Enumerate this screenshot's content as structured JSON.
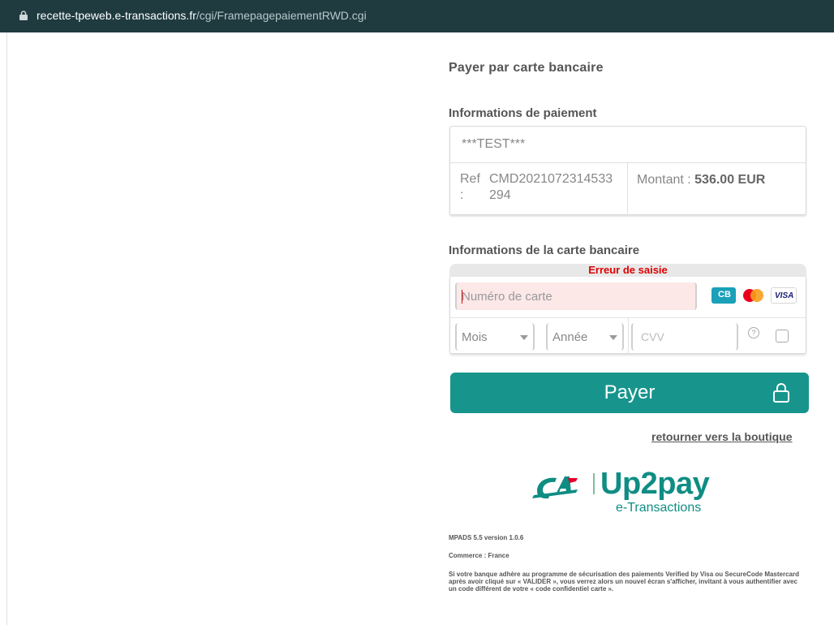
{
  "browser": {
    "url_host": "recette-tpeweb.e-transactions.fr",
    "url_path": "/cgi/FramepagepaiementRWD.cgi"
  },
  "page": {
    "title": "Payer par carte bancaire",
    "payment_info_title": "Informations de paiement",
    "merchant": "***TEST***",
    "ref_label": "Ref :",
    "ref_value": "CMD2021072314533294",
    "amount_label": "Montant :",
    "amount_value": "536.00 EUR",
    "card_info_title": "Informations de la carte bancaire",
    "error_text": "Erreur de saisie",
    "card_number_placeholder": "Numéro de carte",
    "month_label": "Mois",
    "year_label": "Année",
    "cvv_placeholder": "CVV",
    "help_glyph": "?",
    "pay_label": "Payer",
    "back_link": "retourner vers la boutique",
    "logo_brand": "Up2pay",
    "logo_sub": "e-Transactions",
    "version": "MPADS 5.5 version 1.0.6",
    "commerce": "Commerce : France",
    "disclaimer": "Si votre banque adhère au programme de sécurisation des paiements Verified by Visa ou SecureCode Mastercard après avoir cliqué sur « VALIDER », vous verrez alors un nouvel écran s'afficher, invitant à vous authentifier avec un code différent de votre « code confidentiel carte »."
  },
  "card_brands": [
    "CB",
    "Mastercard",
    "VISA"
  ],
  "colors": {
    "address_bar": "#1f3b40",
    "pay_button": "#17958d",
    "error": "#e00000",
    "brand_teal": "#0f8d83"
  },
  "icons": [
    "lock-icon",
    "padlock-icon",
    "help-icon",
    "chevron-down-icon",
    "checkbox-icon"
  ]
}
